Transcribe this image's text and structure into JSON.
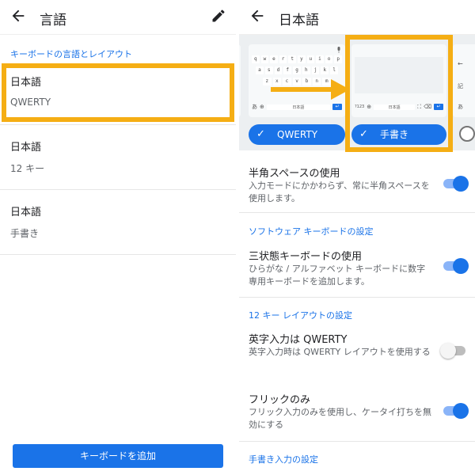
{
  "left": {
    "header": {
      "title": "言語"
    },
    "section_label": "キーボードの言語とレイアウト",
    "items": [
      {
        "name": "日本語",
        "sub": "QWERTY"
      },
      {
        "name": "日本語",
        "sub": "12 キー"
      },
      {
        "name": "日本語",
        "sub": "手書き"
      }
    ],
    "add_button": "キーボードを追加"
  },
  "right": {
    "header": {
      "title": "日本語"
    },
    "keyboard_preview": {
      "qwerty_row": [
        "q",
        "w",
        "e",
        "r",
        "t",
        "y",
        "u",
        "i",
        "o",
        "p"
      ],
      "row2": [
        "a",
        "s",
        "d",
        "f",
        "g",
        "h",
        "j",
        "k",
        "l"
      ],
      "row3": [
        "z",
        "x",
        "c",
        "v",
        "b",
        "n",
        "m"
      ],
      "bottom_left": "あ",
      "space_label": "日本語",
      "hand_space_label": "日本語",
      "hand_num_label": "?123",
      "partial_right_label": "あ",
      "partial_right_mid": "記"
    },
    "layouts": [
      {
        "label": "QWERTY",
        "selected": true
      },
      {
        "label": "手書き",
        "selected": true
      }
    ],
    "settings": [
      {
        "title": "半角スペースの使用",
        "desc": "入力モードにかかわらず、常に半角スペースを使用します。",
        "on": true
      },
      {
        "section": "ソフトウェア キーボードの設定"
      },
      {
        "title": "三状態キーボードの使用",
        "desc": "ひらがな / アルファベット キーボードに数字専用キーボードを追加します。",
        "on": true
      },
      {
        "section": "12 キー レイアウトの設定"
      },
      {
        "title": "英字入力は QWERTY",
        "desc": "英字入力時は QWERTY レイアウトを使用する",
        "on": false
      },
      {
        "title": "フリックのみ",
        "desc": "フリック入力のみを使用し、ケータイ打ちを無効にする",
        "on": true
      }
    ],
    "footer_section": "手書き入力の設定"
  },
  "colors": {
    "accent": "#1a73e8",
    "highlight": "#f5ae14"
  }
}
